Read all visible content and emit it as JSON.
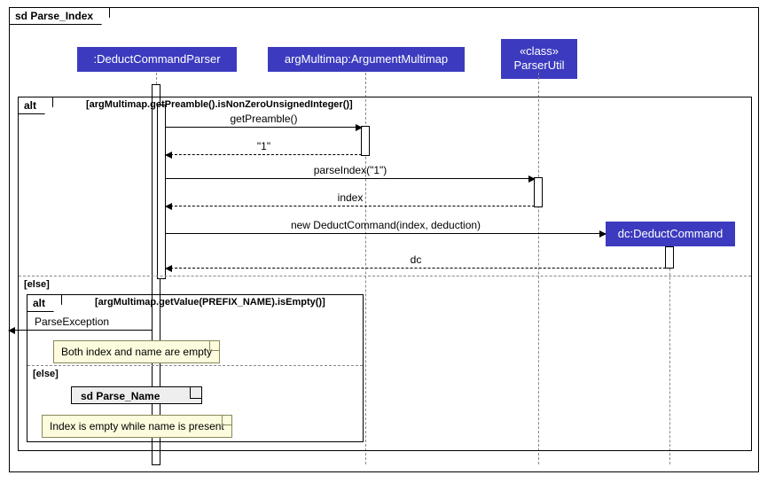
{
  "outer_frame": {
    "label": "sd Parse_Index"
  },
  "lifelines": {
    "parser": {
      "label": ":DeductCommandParser"
    },
    "multimap": {
      "label": "argMultimap:ArgumentMultimap"
    },
    "util": {
      "stereo": "«class»",
      "label": "ParserUtil"
    },
    "dc": {
      "label": "dc:DeductCommand"
    }
  },
  "alt": {
    "label": "alt",
    "guard1": "[argMultimap.getPreamble().isNonZeroUnsignedInteger()]",
    "else": "[else]"
  },
  "messages": {
    "getPreamble": "getPreamble()",
    "ret1": "\"1\"",
    "parseIndex": "parseIndex(\"1\")",
    "retIndex": "index",
    "newDc": "new DeductCommand(index, deduction)",
    "retDc": "dc"
  },
  "inner_alt": {
    "label": "alt",
    "guard1": "[argMultimap.getValue(PREFIX_NAME).isEmpty()]",
    "else": "[else]",
    "exception": "ParseException"
  },
  "notes": {
    "note1": "Both index and name are empty",
    "note2": "Index is empty while name is present"
  },
  "ref": {
    "label": "sd Parse_Name"
  },
  "chart_data": {
    "type": "sequence_diagram",
    "participants": [
      ":DeductCommandParser",
      "argMultimap:ArgumentMultimap",
      "«class» ParserUtil",
      "dc:DeductCommand"
    ],
    "fragments": [
      {
        "type": "alt",
        "guard": "argMultimap.getPreamble().isNonZeroUnsignedInteger()",
        "body": [
          {
            "from": ":DeductCommandParser",
            "to": "argMultimap:ArgumentMultimap",
            "msg": "getPreamble()",
            "kind": "sync"
          },
          {
            "from": "argMultimap:ArgumentMultimap",
            "to": ":DeductCommandParser",
            "msg": "\"1\"",
            "kind": "return"
          },
          {
            "from": ":DeductCommandParser",
            "to": "«class» ParserUtil",
            "msg": "parseIndex(\"1\")",
            "kind": "sync"
          },
          {
            "from": "«class» ParserUtil",
            "to": ":DeductCommandParser",
            "msg": "index",
            "kind": "return"
          },
          {
            "from": ":DeductCommandParser",
            "to": "dc:DeductCommand",
            "msg": "new DeductCommand(index, deduction)",
            "kind": "create"
          },
          {
            "from": "dc:DeductCommand",
            "to": ":DeductCommandParser",
            "msg": "dc",
            "kind": "return"
          }
        ],
        "else": {
          "type": "alt",
          "guard": "argMultimap.getValue(PREFIX_NAME).isEmpty()",
          "body": [
            {
              "from": ":DeductCommandParser",
              "to": "caller",
              "msg": "ParseException",
              "kind": "exception"
            },
            {
              "note": "Both index and name are empty"
            }
          ],
          "else": {
            "ref": "sd Parse_Name",
            "note": "Index is empty while name is present"
          }
        }
      }
    ]
  }
}
